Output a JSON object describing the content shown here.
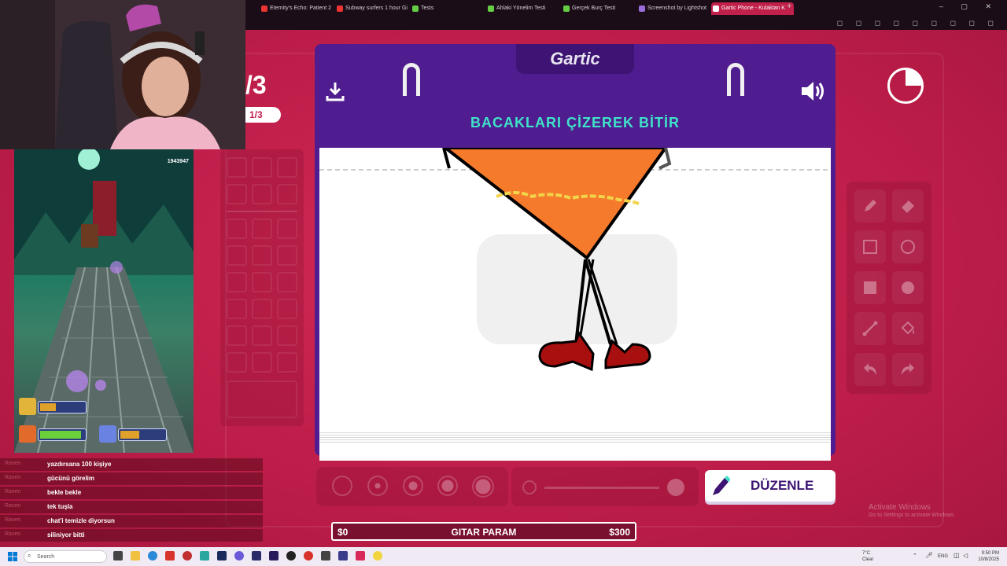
{
  "browser": {
    "tabs": [
      {
        "label": "Eternity's Echo: Patient 2",
        "color": "#e33"
      },
      {
        "label": "Subway surfers 1 hour Gi",
        "color": "#e33"
      },
      {
        "label": "Tests",
        "color": "#6c4"
      },
      {
        "label": "Ahlaki Yönelim Testi",
        "color": "#6c4"
      },
      {
        "label": "Gerçek Burç Testi",
        "color": "#6c4"
      },
      {
        "label": "Screenshot by Lightshot",
        "color": "#9a6cd8"
      },
      {
        "label": "Gartic Phone - Kulaktan K",
        "color": "#fff"
      }
    ],
    "new_tab": "+"
  },
  "game": {
    "round_big": "/3",
    "round_pill": "1/3",
    "logo": "Gartic",
    "instruction": "BACAKLARI ÇİZEREK BİTİR",
    "edit_button": "DÜZENLE",
    "colors": {
      "card": "#4f1d8f",
      "title": "#3fe3c9",
      "background": "#c41f4d"
    }
  },
  "overlay": {
    "money_left": "$0",
    "money_title": "GITAR PARAM",
    "money_right": "$300",
    "phone_score": "1943947"
  },
  "chat": [
    {
      "user": "Raven",
      "msg": "yazdırsana 100 kişiye"
    },
    {
      "user": "Raven",
      "msg": "gücünü görelim"
    },
    {
      "user": "Raven",
      "msg": "bekle bekle"
    },
    {
      "user": "Raven",
      "msg": "tek tuşla"
    },
    {
      "user": "Raven",
      "msg": "chat'i temizle diyorsun"
    },
    {
      "user": "Raven",
      "msg": "siliniyor bitti"
    }
  ],
  "windows": {
    "activate_title": "Activate Windows",
    "activate_sub": "Go to Settings to activate Windows.",
    "search_placeholder": "Search",
    "weather_temp": "7°C",
    "weather_desc": "Clear",
    "lang": "ENG",
    "time": "9:50 PM",
    "date": "10/8/2025"
  }
}
